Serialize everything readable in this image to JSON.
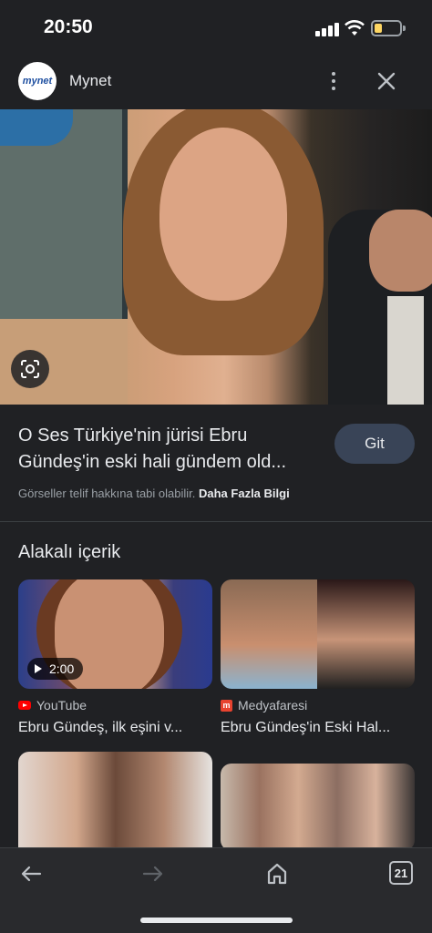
{
  "status_bar": {
    "time": "20:50"
  },
  "header": {
    "site_logo_text": "mynet",
    "site_name": "Mynet"
  },
  "result": {
    "title": "O Ses Türkiye'nin jürisi Ebru Gündeş'in eski hali gündem old...",
    "visit_button": "Git",
    "copyright_notice": "Görseller telif hakkına tabi olabilir.",
    "more_info_link": "Daha Fazla Bilgi"
  },
  "related": {
    "heading": "Alakalı içerik",
    "cards": [
      {
        "source": "YouTube",
        "title": "Ebru Gündeş, ilk eşini v...",
        "duration": "2:00"
      },
      {
        "source": "Medyafaresi",
        "title": "Ebru Gündeş'in Eski Hal..."
      },
      {
        "source": "",
        "title": ""
      },
      {
        "source": "",
        "title": ""
      }
    ]
  },
  "toolbar": {
    "tab_count": "21"
  },
  "colors": {
    "background": "#202124",
    "button": "#394457",
    "toolbar": "#292a2d",
    "battery": "#fdd663"
  }
}
